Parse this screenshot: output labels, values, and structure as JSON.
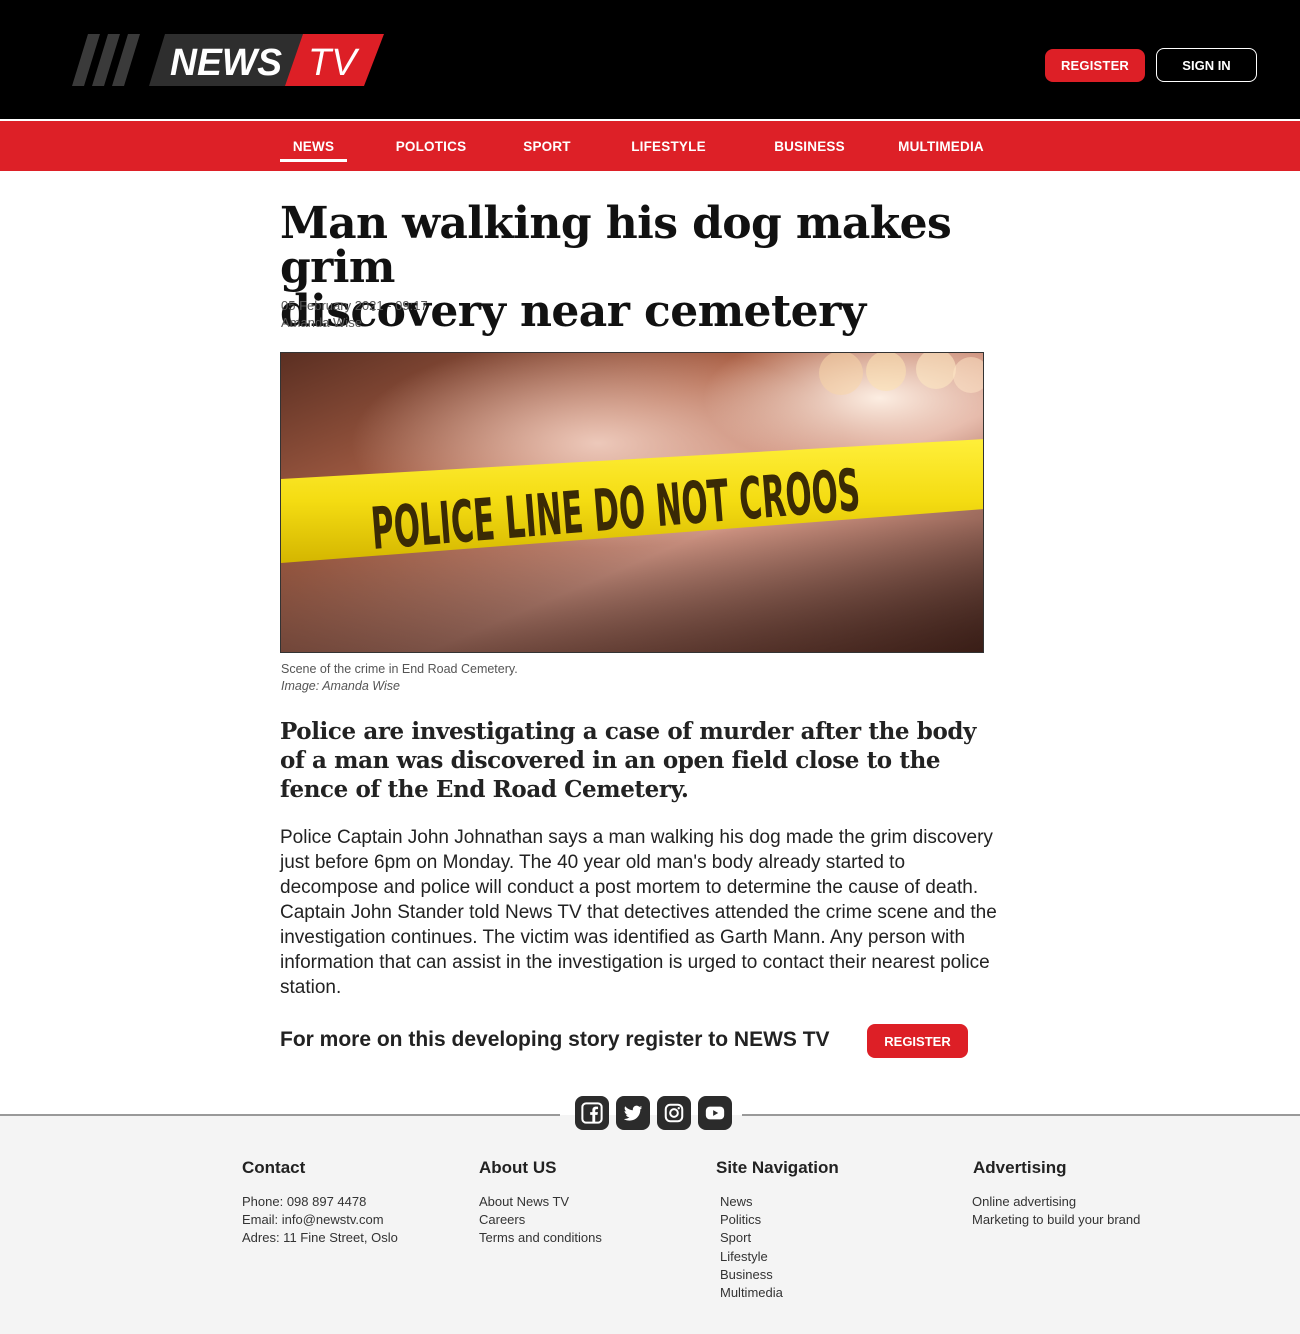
{
  "brand": {
    "name_part1": "NEWS",
    "name_part2": "TV",
    "accent": "#dd1f26"
  },
  "header": {
    "register_label": "REGISTER",
    "signin_label": "SIGN IN"
  },
  "nav": {
    "items": [
      "NEWS",
      "POLOTICS",
      "SPORT",
      "LIFESTYLE",
      "BUSINESS",
      "MULTIMEDIA"
    ],
    "active": "NEWS"
  },
  "article": {
    "headline_line1": "Man walking his dog makes grim",
    "headline_line2": "discovery near cemetery",
    "date": "05 February 2021 - 09:17",
    "author": "Amanda Wise",
    "image_tape_text": "POLICE LINE DO NOT CROOS",
    "caption": "Scene of the crime in End Road Cemetery.",
    "image_credit": "Image: Amanda Wise",
    "lede": "Police are investigating a case of murder after the body of a man was discovered in an open field close to the fence of the End Road Cemetery.",
    "body": "Police Captain John Johnathan says a man walking his dog made the grim discovery just before 6pm on Monday. The 40 year old man's body already started to decompose and police will conduct a post mortem to determine the cause of death. Captain John Stander told News TV that detectives attended the crime scene and the investigation continues. The victim was identified as Garth Mann. Any person with information that can assist in the investigation is urged to contact their nearest police station."
  },
  "cta": {
    "text": "For more on this developing story register to NEWS TV",
    "button_label": "REGISTER"
  },
  "social": [
    "facebook-icon",
    "twitter-icon",
    "instagram-icon",
    "youtube-icon"
  ],
  "footer": {
    "contact": {
      "title": "Contact",
      "lines": [
        "Phone: 098 897 4478",
        "Email: info@newstv.com",
        "Adres: 11 Fine Street, Oslo"
      ]
    },
    "about": {
      "title": "About US",
      "links": [
        "About News TV",
        "Careers",
        "Terms and conditions"
      ]
    },
    "site_nav": {
      "title": "Site Navigation",
      "links": [
        "News",
        "Politics",
        "Sport",
        "Lifestyle",
        "Business",
        "Multimedia"
      ]
    },
    "advertising": {
      "title": "Advertising",
      "links": [
        "Online advertising",
        "Marketing to build your brand"
      ]
    }
  }
}
